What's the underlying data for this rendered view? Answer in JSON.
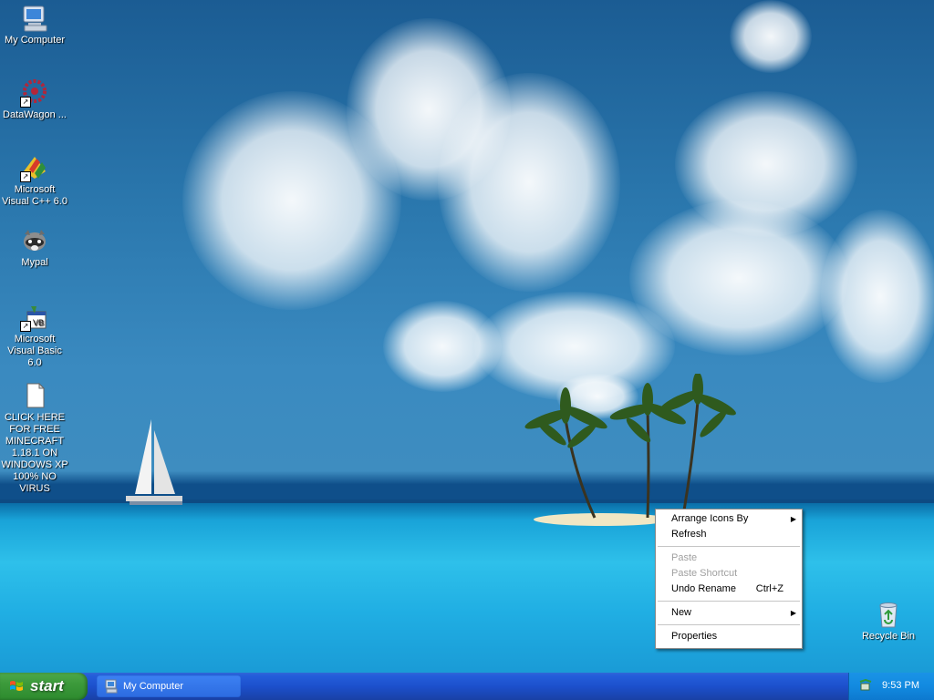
{
  "desktop": {
    "icons": [
      {
        "label": "My Computer",
        "icon": "computer-icon"
      },
      {
        "label": "DataWagon ...",
        "icon": "datawagon-icon"
      },
      {
        "label": "Microsoft Visual C++ 6.0",
        "icon": "visual-cpp-icon"
      },
      {
        "label": "Mypal",
        "icon": "mypal-raccoon-icon"
      },
      {
        "label": "Microsoft Visual Basic 6.0",
        "icon": "visual-basic-icon"
      },
      {
        "label": "CLICK HERE FOR FREE MINECRAFT 1.18.1 ON WINDOWS XP 100% NO VIRUS",
        "icon": "text-file-icon"
      },
      {
        "label": "Recycle Bin",
        "icon": "recycle-bin-icon"
      }
    ]
  },
  "context_menu": {
    "items": [
      {
        "label": "Arrange Icons By",
        "submenu": true,
        "enabled": true
      },
      {
        "label": "Refresh",
        "enabled": true
      },
      {
        "label": "Paste",
        "enabled": false
      },
      {
        "label": "Paste Shortcut",
        "enabled": false
      },
      {
        "label": "Undo Rename",
        "shortcut": "Ctrl+Z",
        "enabled": true
      },
      {
        "label": "New",
        "submenu": true,
        "enabled": true
      },
      {
        "label": "Properties",
        "enabled": true
      }
    ]
  },
  "taskbar": {
    "start_label": "start",
    "tasks": [
      {
        "label": "My Computer"
      }
    ],
    "clock": "9:53 PM"
  },
  "colors": {
    "taskbar_blue": "#245edb",
    "start_green": "#3c9a3b",
    "tray_blue": "#128ae0"
  }
}
